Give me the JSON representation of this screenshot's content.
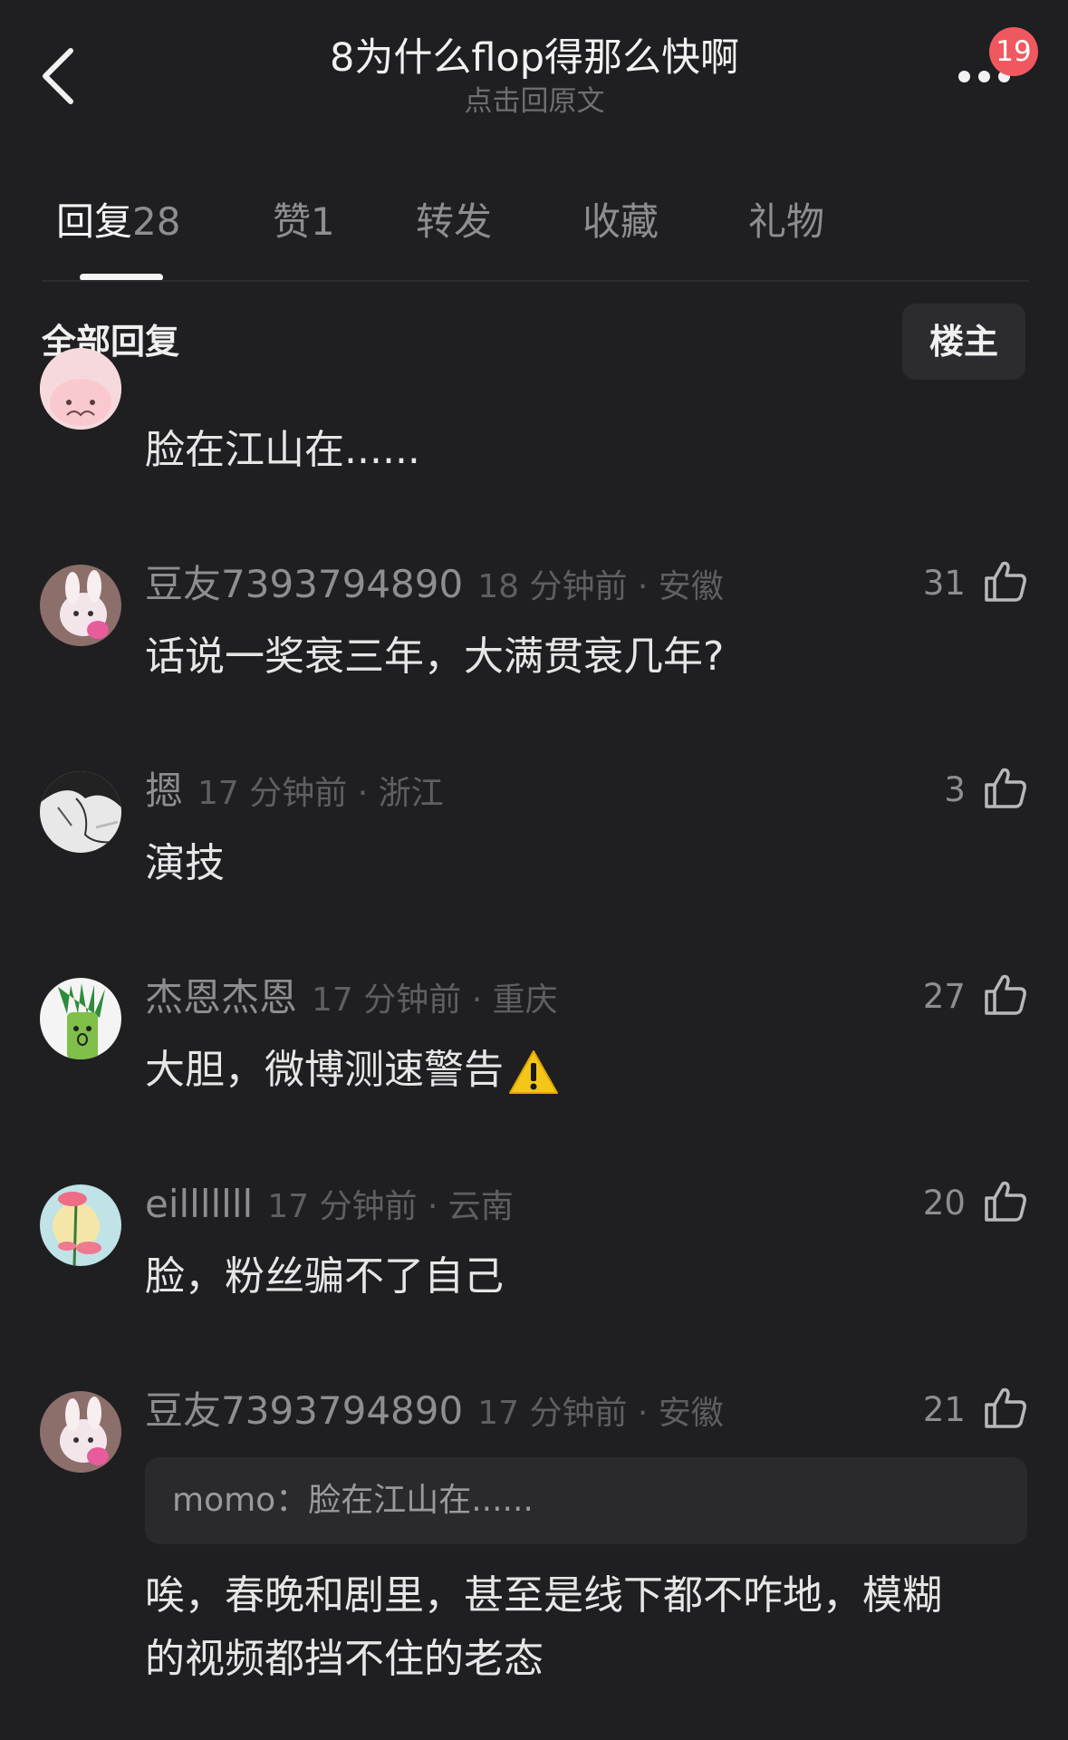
{
  "header": {
    "title": "8为什么flop得那么快啊",
    "subtitle": "点击回原文",
    "notification_count": "19"
  },
  "tabs": [
    {
      "name": "回复",
      "count": "28",
      "active": true
    },
    {
      "name": "赞",
      "count": "1",
      "active": false
    },
    {
      "name": "转发",
      "count": "",
      "active": false
    },
    {
      "name": "收藏",
      "count": "",
      "active": false
    },
    {
      "name": "礼物",
      "count": "",
      "active": false
    }
  ],
  "section": {
    "title": "全部回复",
    "op_filter_label": "楼主"
  },
  "comments": [
    {
      "content": "脸在江山在......"
    },
    {
      "username": "豆友7393794890",
      "time_location": "18 分钟前 · 安徽",
      "likes": "31",
      "content": "话说一奖衰三年，大满贯衰几年?"
    },
    {
      "username": "摁",
      "time_location": "17 分钟前 · 浙江",
      "likes": "3",
      "content": "演技"
    },
    {
      "username": "杰恩杰恩",
      "time_location": "17 分钟前 · 重庆",
      "likes": "27",
      "content": "大胆，微博测速警告",
      "emoji": "warning-icon"
    },
    {
      "username": "eilllllll",
      "time_location": "17 分钟前 · 云南",
      "likes": "20",
      "content": "脸，粉丝骗不了自己"
    },
    {
      "username": "豆友7393794890",
      "time_location": "17 分钟前 · 安徽",
      "likes": "21",
      "quote": "momo：脸在江山在......",
      "content_line1": "唉，春晚和剧里，甚至是线下都不咋地，模糊",
      "content_line2": "的视频都挡不住的老态"
    }
  ],
  "colors": {
    "background": "#1f1f22",
    "badge": "#f0585f",
    "text_primary": "#e6e6e6",
    "text_secondary": "#8e8e92",
    "text_tertiary": "#5f5f63"
  }
}
